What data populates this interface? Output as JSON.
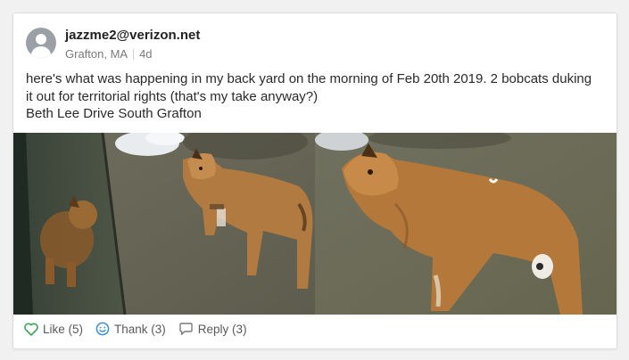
{
  "post": {
    "author": "jazzme2@verizon.net",
    "location": "Grafton, MA",
    "age": "4d",
    "body_lines": [
      "here's what was happening in my back yard on the morning of Feb 20th 2019. 2 bobcats duking it out for territorial rights (that's my take anyway?)",
      "Beth Lee Drive South Grafton"
    ]
  },
  "actions": {
    "like": "Like (5)",
    "thank": "Thank (3)",
    "reply": "Reply (3)"
  },
  "colors": {
    "like_icon": "#3aa655",
    "thank_icon": "#3a8fd6",
    "reply_icon": "#7a7a7a"
  },
  "icons": {
    "like": "heart-outline-icon",
    "thank": "smiley-icon",
    "reply": "speech-bubble-icon"
  }
}
